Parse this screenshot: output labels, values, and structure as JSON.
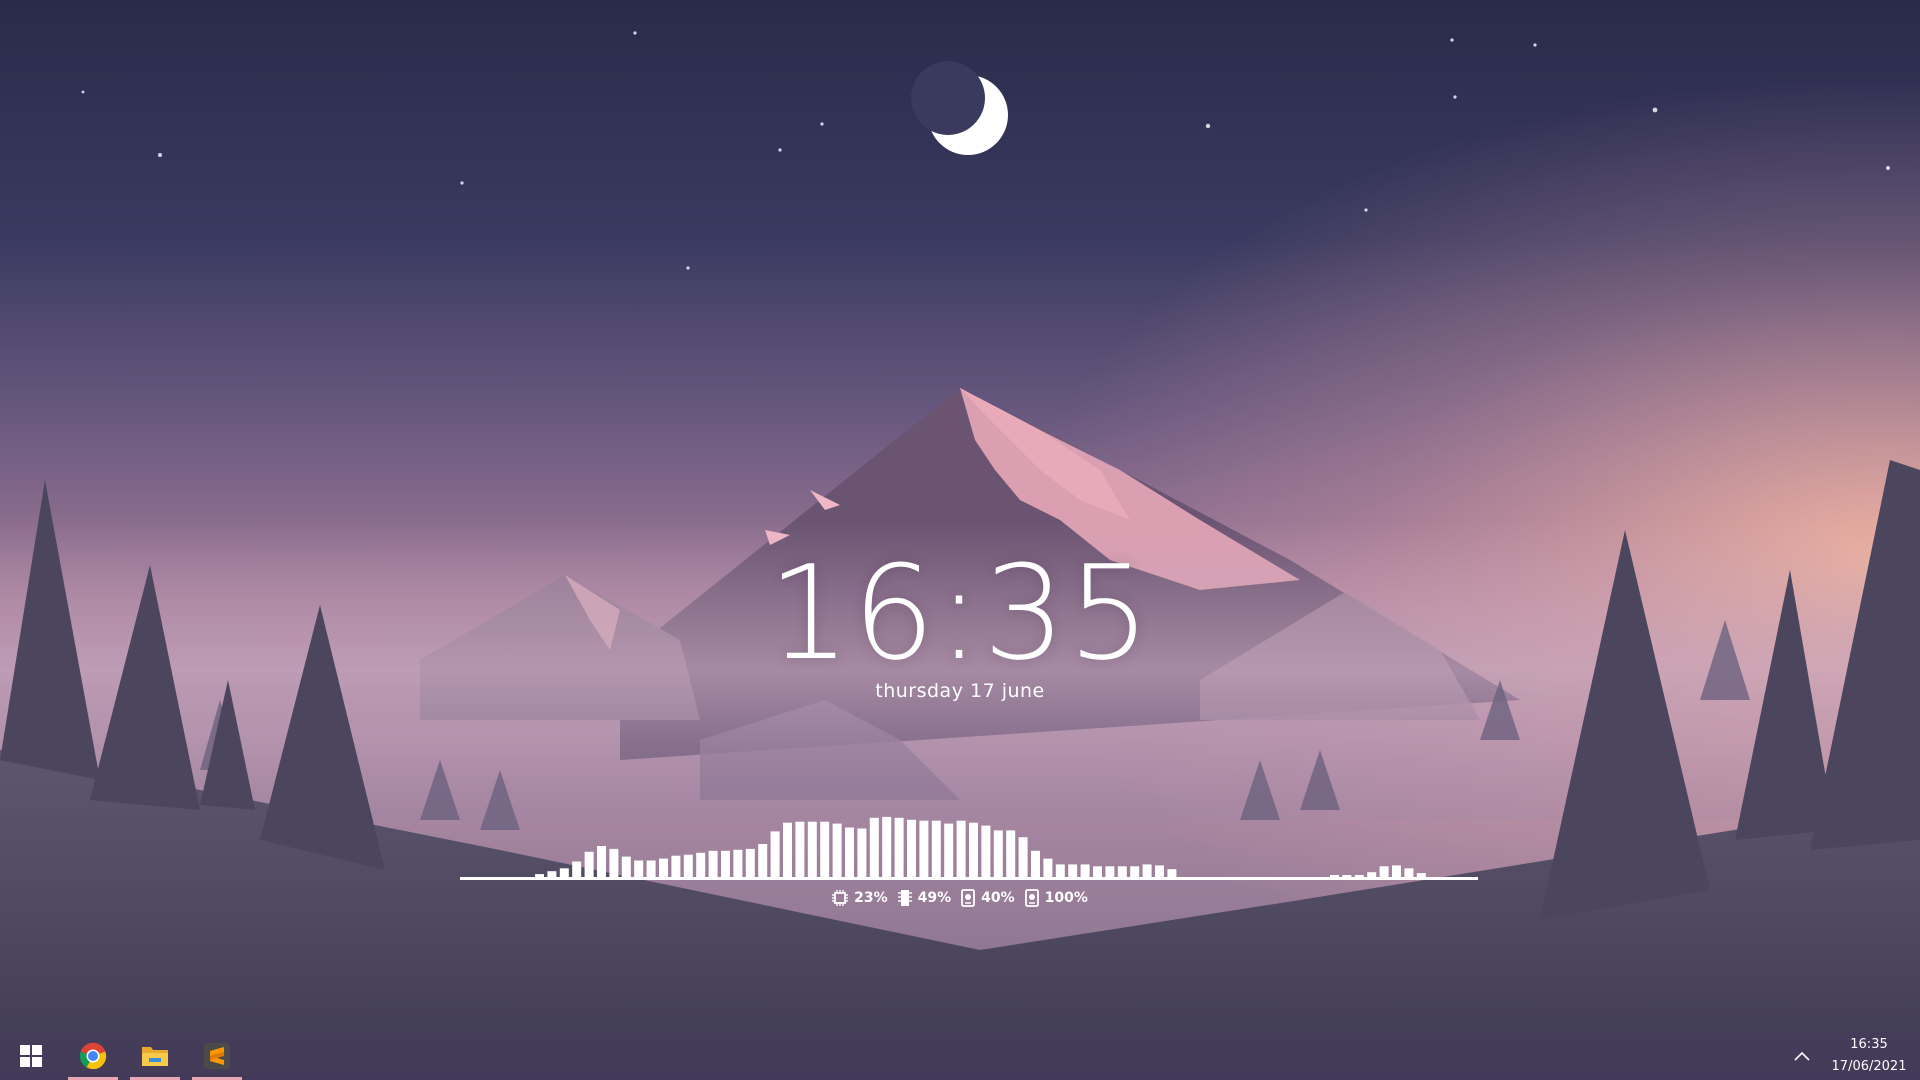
{
  "clock": {
    "time": "16:35",
    "date": "thursday 17 june"
  },
  "visualizer": {
    "left_levels": [
      0.03,
      0.06,
      0.09,
      0.16,
      0.26,
      0.32,
      0.29,
      0.21,
      0.17,
      0.17,
      0.19,
      0.22,
      0.23,
      0.25,
      0.27,
      0.27,
      0.28,
      0.29,
      0.34,
      0.47,
      0.56,
      0.57,
      0.57,
      0.57,
      0.55,
      0.51,
      0.5,
      0.61,
      0.62,
      0.61,
      0.59,
      0.58,
      0.58,
      0.55,
      0.58,
      0.56,
      0.53,
      0.48,
      0.48,
      0.41,
      0.27,
      0.19,
      0.13,
      0.13,
      0.13,
      0.11,
      0.11,
      0.11,
      0.11,
      0.13,
      0.12,
      0.08
    ],
    "right_levels": [
      0.02,
      0.02,
      0.02,
      0.05,
      0.11,
      0.12,
      0.09,
      0.04
    ],
    "color": "#ffffff"
  },
  "stats": {
    "cpu": {
      "icon": "cpu-chip-icon",
      "value": "23%"
    },
    "ram": {
      "icon": "memory-stick-icon",
      "value": "49%"
    },
    "disk_c": {
      "icon": "hard-drive-icon",
      "value": "40%"
    },
    "disk_d": {
      "icon": "hard-drive-icon",
      "value": "100%"
    }
  },
  "taskbar": {
    "apps": [
      {
        "icon": "windows-start-icon",
        "running": false
      },
      {
        "icon": "chrome-icon",
        "running": true
      },
      {
        "icon": "file-explorer-icon",
        "running": true
      },
      {
        "icon": "sublime-text-icon",
        "running": true
      }
    ],
    "accent": "#e9a7b6",
    "tray": {
      "chevron_icon": "chevron-up-icon",
      "time": "16:35",
      "date": "17/06/2021"
    }
  },
  "wallpaper": {
    "sky_top": "#2b2b4e",
    "sky_horizon": "#e9a9a6",
    "mountain_peak": "#f0b8c4"
  }
}
